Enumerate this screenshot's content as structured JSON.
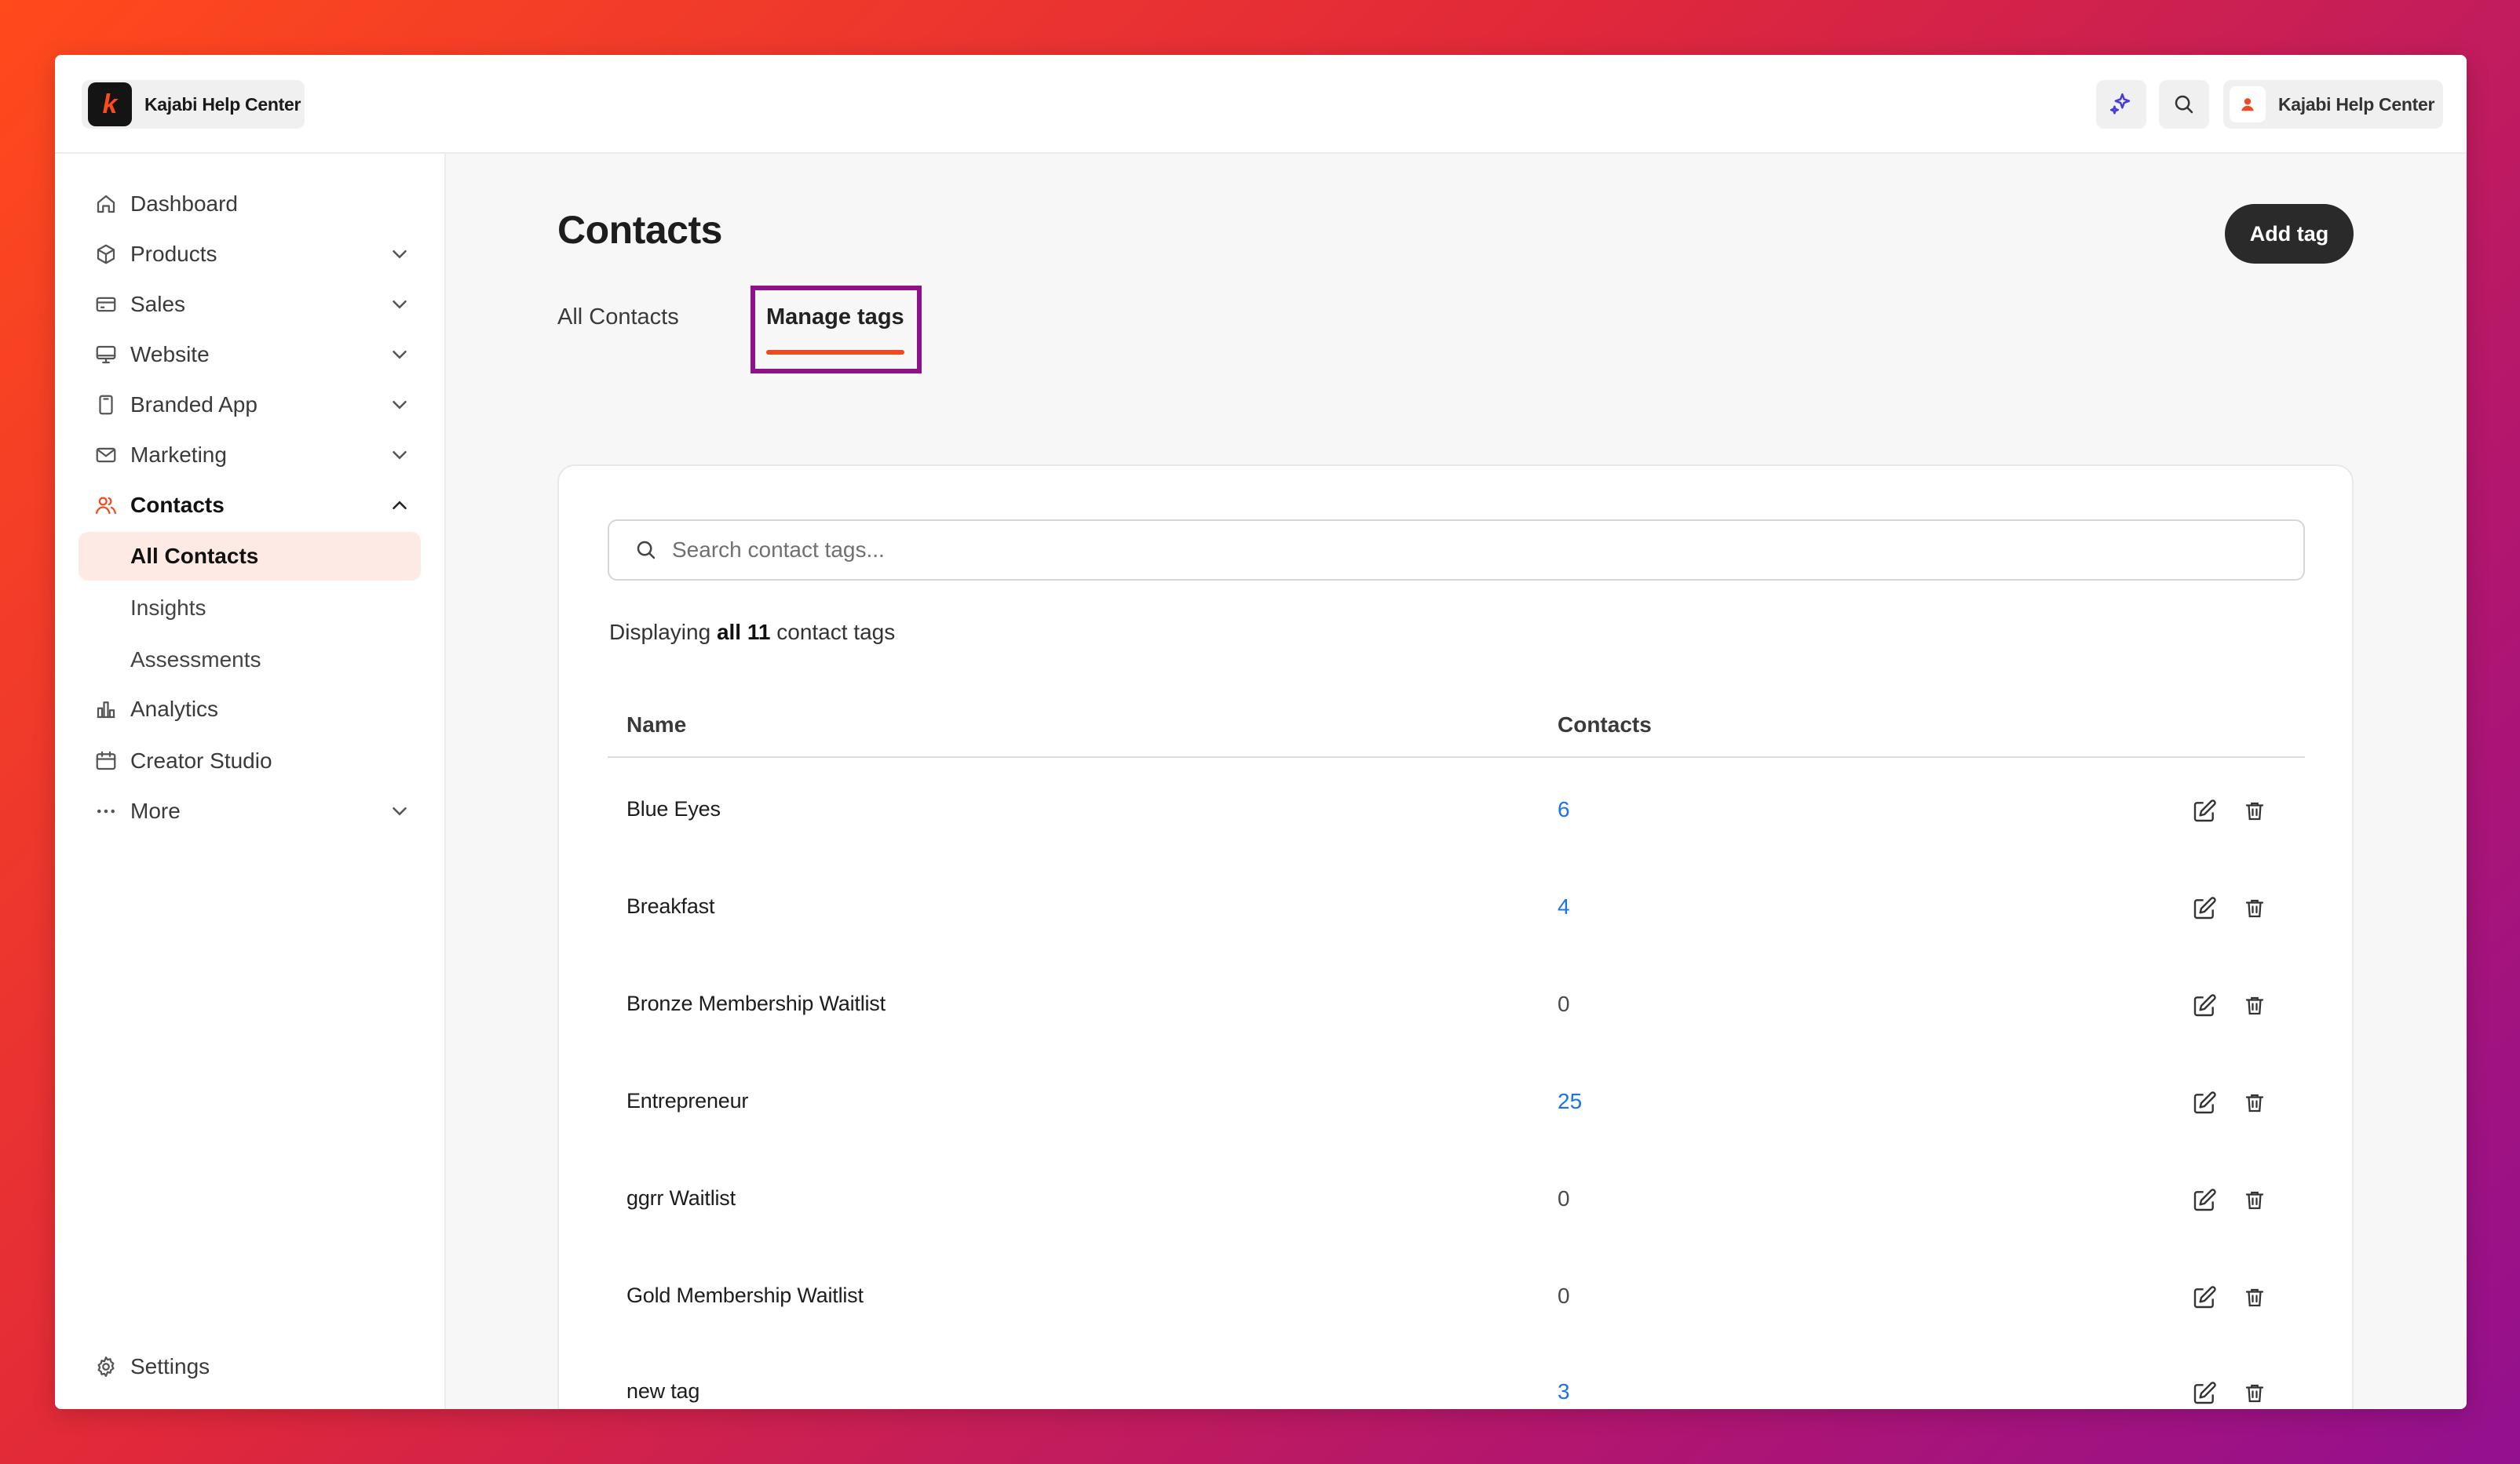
{
  "topbar": {
    "brand_name": "Kajabi Help Center",
    "brand_logo_letter": "k",
    "account_name": "Kajabi Help Center"
  },
  "sidebar": {
    "items": [
      {
        "label": "Dashboard",
        "icon": "home-icon",
        "has_chevron": false
      },
      {
        "label": "Products",
        "icon": "box-icon",
        "has_chevron": true
      },
      {
        "label": "Sales",
        "icon": "credit-card-icon",
        "has_chevron": true
      },
      {
        "label": "Website",
        "icon": "monitor-icon",
        "has_chevron": true
      },
      {
        "label": "Branded App",
        "icon": "mobile-icon",
        "has_chevron": true
      },
      {
        "label": "Marketing",
        "icon": "mail-icon",
        "has_chevron": true
      },
      {
        "label": "Contacts",
        "icon": "users-icon",
        "has_chevron": true,
        "expanded": true
      },
      {
        "label": "Analytics",
        "icon": "bar-chart-icon",
        "has_chevron": false
      },
      {
        "label": "Creator Studio",
        "icon": "calendar-icon",
        "has_chevron": false
      },
      {
        "label": "More",
        "icon": "more-dots-icon",
        "has_chevron": true
      }
    ],
    "contacts_sub": [
      {
        "label": "All Contacts",
        "selected": true
      },
      {
        "label": "Insights",
        "selected": false
      },
      {
        "label": "Assessments",
        "selected": false
      }
    ],
    "settings_label": "Settings"
  },
  "main": {
    "title": "Contacts",
    "add_tag_label": "Add tag",
    "tabs": [
      {
        "label": "All Contacts",
        "active": false
      },
      {
        "label": "Manage tags",
        "active": true
      }
    ],
    "search_placeholder": "Search contact tags...",
    "count_prefix": "Displaying ",
    "count_bold": "all 11",
    "count_suffix": " contact tags",
    "columns": {
      "name": "Name",
      "contacts": "Contacts"
    },
    "rows": [
      {
        "name": "Blue Eyes",
        "contacts": "6",
        "linked": true
      },
      {
        "name": "Breakfast",
        "contacts": "4",
        "linked": true
      },
      {
        "name": "Bronze Membership Waitlist",
        "contacts": "0",
        "linked": false
      },
      {
        "name": "Entrepreneur",
        "contacts": "25",
        "linked": true
      },
      {
        "name": "ggrr Waitlist",
        "contacts": "0",
        "linked": false
      },
      {
        "name": "Gold Membership Waitlist",
        "contacts": "0",
        "linked": false
      },
      {
        "name": "new tag",
        "contacts": "3",
        "linked": true
      }
    ]
  },
  "colors": {
    "accent": "#ef4a20",
    "highlight_box": "#8e1289",
    "link": "#1a73e8",
    "selected_bg": "#fdeae5"
  }
}
